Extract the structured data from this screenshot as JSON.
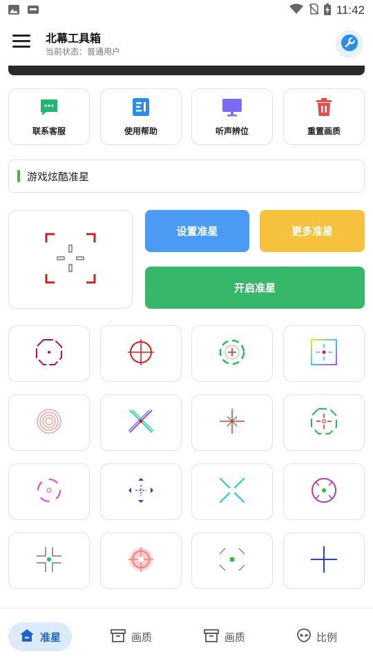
{
  "status_bar": {
    "time": "11:42"
  },
  "app_bar": {
    "title": "北幕工具箱",
    "subtitle": "当前状态：普通用户"
  },
  "functions": [
    {
      "label": "联系客服",
      "icon": "chat-icon",
      "color": "#22b573"
    },
    {
      "label": "使用帮助",
      "icon": "document-icon",
      "color": "#2b8de8"
    },
    {
      "label": "听声辨位",
      "icon": "monitor-icon",
      "color": "#7b6cf6"
    },
    {
      "label": "重置画质",
      "icon": "trash-icon",
      "color": "#e74c4c"
    }
  ],
  "section": {
    "title": "游戏炫酷准星"
  },
  "actions": {
    "set": {
      "label": "设置准星",
      "color": "#4b9bf5"
    },
    "more": {
      "label": "更多准星",
      "color": "#f6c13d"
    },
    "enable": {
      "label": "开启准星",
      "color": "#37b769"
    }
  },
  "crosshairs": [
    "octagon-dot-crosshair-icon",
    "circle-cross-crosshair-icon",
    "dashed-ring-crosshair-icon",
    "gradient-square-crosshair-icon",
    "concentric-rings-crosshair-icon",
    "x-cross-crosshair-icon",
    "red-green-cross-crosshair-icon",
    "green-octagon-crosshair-icon",
    "magenta-brackets-crosshair-icon",
    "blue-arrows-crosshair-icon",
    "cyan-x-crosshair-icon",
    "purple-circle-crosshair-icon",
    "corner-cross-crosshair-icon",
    "glow-circle-crosshair-icon",
    "bracket-square-crosshair-icon",
    "blue-plus-crosshair-icon"
  ],
  "bottom_nav": [
    {
      "label": "准星",
      "icon": "home-icon",
      "active": true
    },
    {
      "label": "画质",
      "icon": "archive-icon",
      "active": false
    },
    {
      "label": "画质",
      "icon": "archive-icon",
      "active": false
    },
    {
      "label": "比例",
      "icon": "alien-icon",
      "active": false
    }
  ]
}
